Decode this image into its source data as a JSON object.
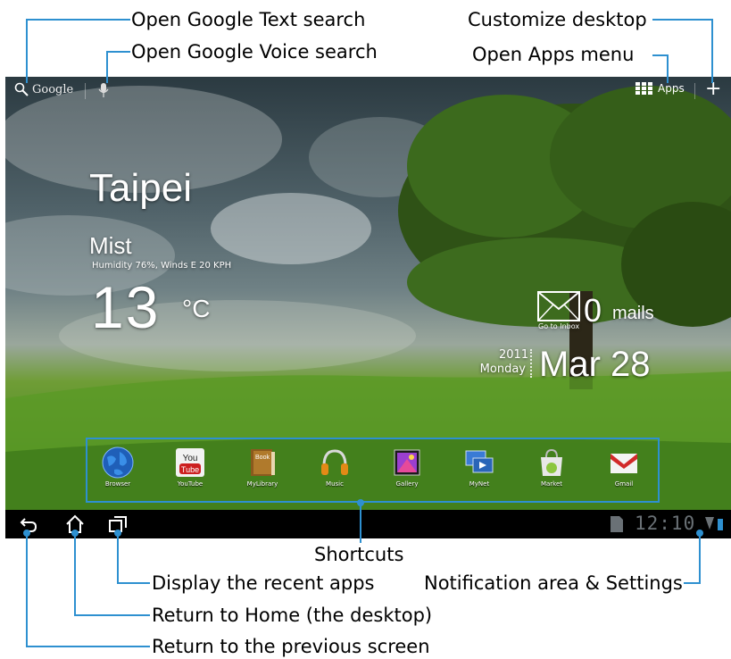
{
  "callouts": {
    "google_text": "Open Google Text search",
    "google_voice": "Open Google Voice search",
    "customize": "Customize desktop",
    "apps_menu": "Open Apps menu",
    "shortcuts": "Shortcuts",
    "recent_apps": "Display the recent apps",
    "notifications": "Notification area & Settings",
    "home": "Return to Home (the desktop)",
    "back": "Return to the previous screen"
  },
  "topbar": {
    "search_label": "Google",
    "apps_label": "Apps"
  },
  "weather": {
    "city": "Taipei",
    "condition": "Mist",
    "details": "Humidity 76%, Winds E 20 KPH",
    "temperature": "13",
    "unit": "°C"
  },
  "mail": {
    "count": "0",
    "label": "mails",
    "link": "Go to Inbox"
  },
  "date": {
    "year": "2011",
    "weekday": "Monday",
    "date": "Mar 28"
  },
  "shortcuts": [
    {
      "label": "Browser",
      "icon": "browser-globe-icon"
    },
    {
      "label": "YouTube",
      "icon": "youtube-icon"
    },
    {
      "label": "MyLibrary",
      "icon": "book-icon"
    },
    {
      "label": "Music",
      "icon": "headphones-icon"
    },
    {
      "label": "Gallery",
      "icon": "gallery-icon"
    },
    {
      "label": "MyNet",
      "icon": "mynet-icon"
    },
    {
      "label": "Market",
      "icon": "market-bag-icon"
    },
    {
      "label": "Gmail",
      "icon": "gmail-icon"
    }
  ],
  "youtube_logo": {
    "top": "You",
    "bottom": "Tube"
  },
  "mylibrary_logo": "Book",
  "statusbar": {
    "clock": "12:10"
  },
  "colors": {
    "callout_line": "#2e90d0",
    "system_bar": "#000000",
    "clock": "#6a7176"
  }
}
